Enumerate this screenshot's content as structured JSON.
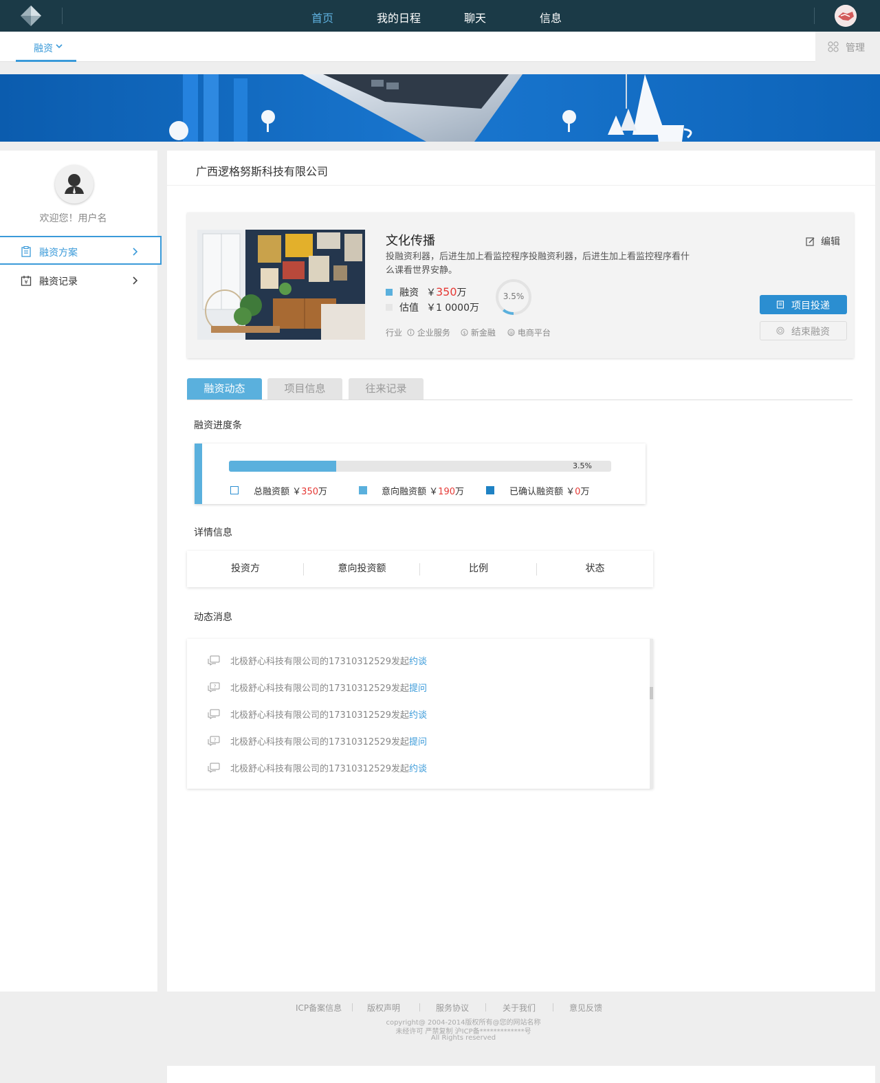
{
  "topnav": {
    "items": [
      {
        "label": "首页",
        "active": true
      },
      {
        "label": "我的日程",
        "active": false
      },
      {
        "label": "聊天",
        "active": false
      },
      {
        "label": "信息",
        "active": false
      }
    ]
  },
  "subnav": {
    "tab_label": "融资",
    "manage_label": "管理"
  },
  "sidebar": {
    "welcome": "欢迎您！用户名",
    "items": [
      {
        "label": "融资方案",
        "icon": "clipboard-icon",
        "active": true
      },
      {
        "label": "融资记录",
        "icon": "calendar-yen-icon",
        "active": false
      }
    ]
  },
  "main": {
    "company_title": "广西逻格努斯科技有限公司",
    "project": {
      "name": "文化传播",
      "description": "投融资利器，后进生加上看监控程序投融资利器，后进生加上看监控程序看什么课看世界安静。",
      "financing_label": "融资",
      "financing_currency": "￥",
      "financing_value": "350",
      "financing_unit": "万",
      "valuation_label": "估值",
      "valuation_value": "￥1 0000万",
      "ratio_text": "3.5%",
      "ratio_fraction": 0.035,
      "tags": [
        "行业",
        "企业服务",
        "新金融",
        "电商平台"
      ],
      "edit_label": "编辑",
      "primary_button": "项目投递",
      "secondary_button": "结束融资"
    },
    "tabs": [
      {
        "label": "融资动态",
        "active": true
      },
      {
        "label": "项目信息",
        "active": false
      },
      {
        "label": "往来记录",
        "active": false
      }
    ],
    "progress": {
      "section_title": "融资进度条",
      "percent_text": "3.5%",
      "fill_fraction": 0.28,
      "legend": [
        {
          "label": "总融资额",
          "currency": "￥",
          "value": "350",
          "unit": "万",
          "style": "outline"
        },
        {
          "label": "意向融资额",
          "currency": "￥",
          "value": "190",
          "unit": "万",
          "style": "light"
        },
        {
          "label": "已确认融资额",
          "currency": "￥",
          "value": "0",
          "unit": "万",
          "style": "dark"
        }
      ]
    },
    "detail": {
      "section_title": "详情信息",
      "columns": [
        "投资方",
        "意向投资额",
        "比例",
        "状态"
      ]
    },
    "messages": {
      "section_title": "动态消息",
      "items": [
        {
          "text": "北极舒心科技有限公司的17310312529发起",
          "action": "约谈",
          "icon": "chat-icon"
        },
        {
          "text": "北极舒心科技有限公司的17310312529发起",
          "action": "提问",
          "icon": "question-chat-icon"
        },
        {
          "text": "北极舒心科技有限公司的17310312529发起",
          "action": "约谈",
          "icon": "chat-icon"
        },
        {
          "text": "北极舒心科技有限公司的17310312529发起",
          "action": "提问",
          "icon": "question-chat-icon"
        },
        {
          "text": "北极舒心科技有限公司的17310312529发起",
          "action": "约谈",
          "icon": "chat-icon"
        }
      ]
    }
  },
  "footer": {
    "links": [
      "ICP备案信息",
      "版权声明",
      "服务协议",
      "关于我们",
      "意见反馈"
    ],
    "copyright": "copyright@ 2004-2014版权所有@您的网站名称",
    "notice": "未经许可 严禁复制 沪ICP备*************号",
    "rights": "All Rights reserved"
  },
  "colors": {
    "nav_bg": "#1b3a47",
    "accent": "#3a9ad9",
    "progress": "#5ab0dd",
    "highlight": "#e53935"
  }
}
